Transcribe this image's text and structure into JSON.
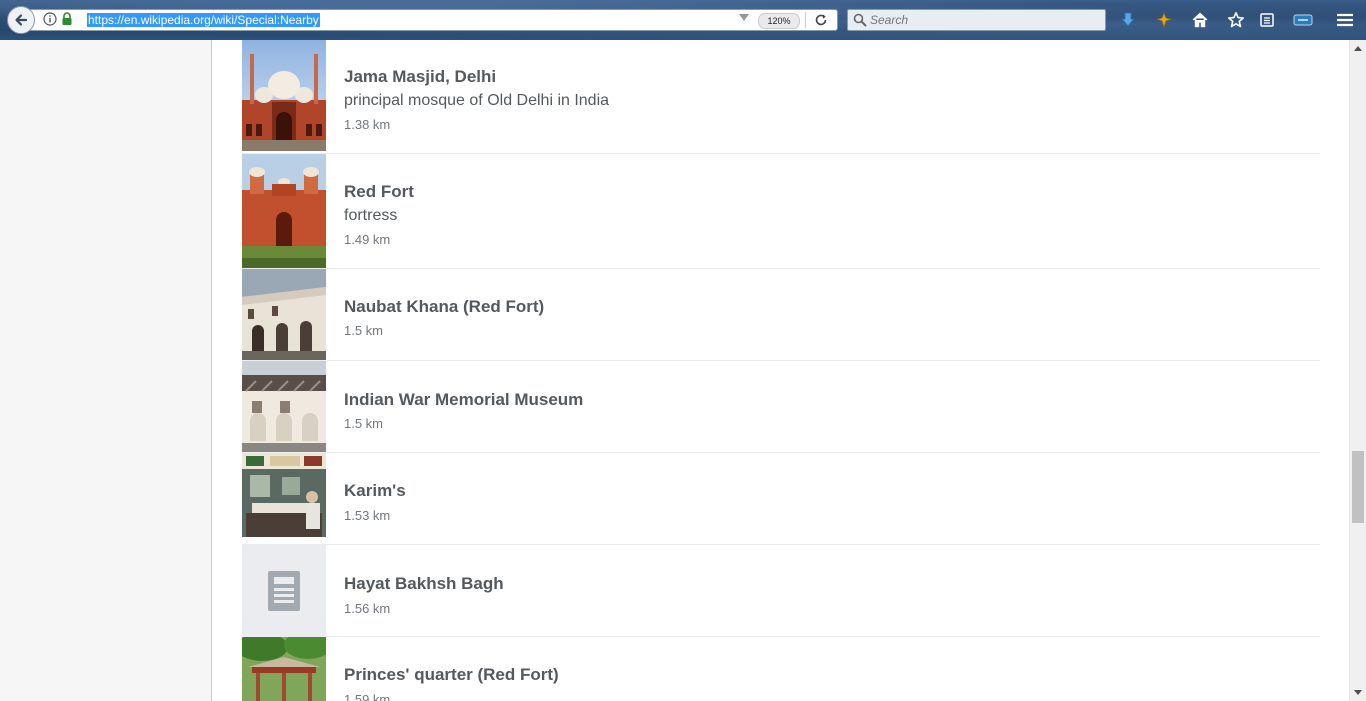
{
  "browser": {
    "url": "https://en.wikipedia.org/wiki/Special:Nearby",
    "zoom": "120%",
    "search_placeholder": "Search"
  },
  "nearby": {
    "items": [
      {
        "title": "Jama Masjid, Delhi",
        "description": "principal mosque of Old Delhi in India",
        "distance": "1.38 km",
        "thumbnail": "mosque-photo"
      },
      {
        "title": "Red Fort",
        "description": "fortress",
        "distance": "1.49 km",
        "thumbnail": "red-fort-photo"
      },
      {
        "title": "Naubat Khana (Red Fort)",
        "description": "",
        "distance": "1.5 km",
        "thumbnail": "white-building-photo"
      },
      {
        "title": "Indian War Memorial Museum",
        "description": "",
        "distance": "1.5 km",
        "thumbnail": "museum-photo"
      },
      {
        "title": "Karim's",
        "description": "",
        "distance": "1.53 km",
        "thumbnail": "restaurant-photo"
      },
      {
        "title": "Hayat Bakhsh Bagh",
        "description": "",
        "distance": "1.56 km",
        "thumbnail": "placeholder-article-icon"
      },
      {
        "title": "Princes' quarter (Red Fort)",
        "description": "",
        "distance": "1.59 km",
        "thumbnail": "garden-pavilion-photo"
      }
    ]
  },
  "colors": {
    "title": "#54595d",
    "distance": "#72777d",
    "url_selection": "#3399ff"
  }
}
